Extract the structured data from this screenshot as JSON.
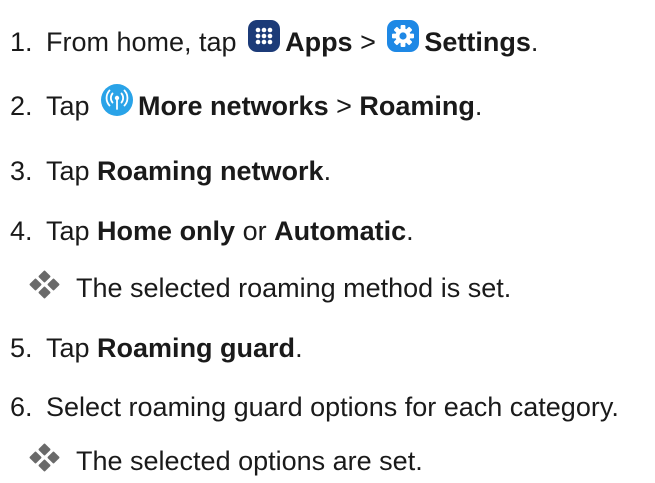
{
  "steps": [
    {
      "num": "1.",
      "t1": "From home, tap ",
      "b1": "Apps",
      "t2": " > ",
      "b2": "Settings",
      "t3": "."
    },
    {
      "num": "2.",
      "t1": "Tap ",
      "b1": "More networks",
      "t2": " > ",
      "b2": "Roaming",
      "t3": "."
    },
    {
      "num": "3.",
      "t1": "Tap ",
      "b1": "Roaming network",
      "t2": "."
    },
    {
      "num": "4.",
      "t1": "Tap ",
      "b1": "Home only",
      "t2": " or ",
      "b2": "Automatic",
      "t3": "."
    },
    {
      "num": "5.",
      "t1": "Tap ",
      "b1": "Roaming guard",
      "t2": "."
    },
    {
      "num": "6.",
      "t1": "Select roaming guard options for each category."
    }
  ],
  "notes": [
    "The selected roaming method is set.",
    "The selected options are set."
  ],
  "icons": {
    "apps": "apps-grid-icon",
    "settings": "gear-icon",
    "more_networks": "wireless-signal-icon"
  },
  "colors": {
    "text": "#1a1a1a",
    "apps_icon": "#1c3b78",
    "settings_icon": "#1e88e5",
    "more_networks_icon": "#29a3e8",
    "bullet": "#6a6a6a"
  }
}
